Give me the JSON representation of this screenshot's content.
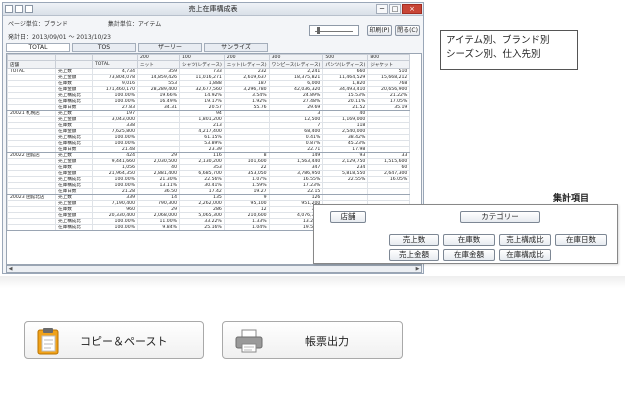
{
  "window": {
    "title": "売上在庫構成表",
    "controls": {
      "minimize": "─",
      "maximize": "□",
      "close": "×"
    }
  },
  "info": {
    "page_unit": "ページ単位：ブランド",
    "aggregate_unit": "集計単位：アイテム",
    "period": "発計日：2013/09/01 ～ 2013/10/23"
  },
  "header_buttons": {
    "print": "印刷(P)",
    "close": "閉る(C)"
  },
  "tabs": [
    "TOTAL",
    "TOS",
    "ザーリー",
    "サンライズ"
  ],
  "table": {
    "col_codes": [
      "",
      "",
      "",
      "200",
      "100",
      "200",
      "300",
      "500",
      "800"
    ],
    "col_headers": [
      "店舗",
      "",
      "TOTAL",
      "ニット",
      "シャツ(レディース)",
      "ニット(レディース)",
      "ワンピース(レディース)",
      "パンツ(レディース)",
      "ジャケット"
    ],
    "groups": [
      {
        "store": "TOTAL",
        "rows": [
          {
            "metric": "売上数",
            "values": [
              "4,734",
              "359",
              "733",
              "232",
              "2,241",
              "660",
              "510"
            ]
          },
          {
            "metric": "売上金額",
            "values": [
              "73,804,078",
              "14,859,426",
              "11,016,271",
              "2,619,637",
              "18,375,821",
              "11,464,529",
              "15,668,212"
            ]
          },
          {
            "metric": "在庫数",
            "values": [
              "9,016",
              "553",
              "1,888",
              "187",
              "6,000",
              "1,820",
              "768"
            ]
          },
          {
            "metric": "在庫金額",
            "values": [
              "171,460,170",
              "28,289,400",
              "32,677,560",
              "3,296,780",
              "42,036,320",
              "34,493,410",
              "20,656,900"
            ]
          },
          {
            "metric": "売上構成比",
            "values": [
              "100.00%",
              "19.66%",
              "14.92%",
              "3.54%",
              "24.89%",
              "15.53%",
              "21.22%"
            ]
          },
          {
            "metric": "在庫構成比",
            "values": [
              "100.00%",
              "16.49%",
              "19.17%",
              "1.92%",
              "27.48%",
              "20.11%",
              "17.05%"
            ]
          },
          {
            "metric": "在庫日数",
            "values": [
              "27.83",
              "34.31",
              "20.57",
              "55.76",
              "29.69",
              "21.52",
              "35.19"
            ]
          }
        ]
      },
      {
        "store": "20021 札幌店",
        "rows": [
          {
            "metric": "売上数",
            "values": [
              "197",
              "",
              "94",
              "",
              "3",
              "40",
              ""
            ]
          },
          {
            "metric": "売上金額",
            "values": [
              "3,043,000",
              "",
              "1,801,200",
              "",
              "12,500",
              "1,169,000",
              ""
            ]
          },
          {
            "metric": "在庫数",
            "values": [
              "338",
              "",
              "213",
              "",
              "7",
              "118",
              ""
            ]
          },
          {
            "metric": "在庫金額",
            "values": [
              "7,625,800",
              "",
              "4,217,400",
              "",
              "68,400",
              "2,540,000",
              ""
            ]
          },
          {
            "metric": "売上構成比",
            "values": [
              "100.00%",
              "",
              "61.15%",
              "",
              "0.41%",
              "38.42%",
              ""
            ]
          },
          {
            "metric": "在庫構成比",
            "values": [
              "100.00%",
              "",
              "53.89%",
              "",
              "0.87%",
              "45.23%",
              ""
            ]
          },
          {
            "metric": "在庫日数",
            "values": [
              "21.48",
              "",
              "23.39",
              "",
              "22.71",
              "17.98",
              ""
            ]
          }
        ]
      },
      {
        "store": "20022 函館店",
        "rows": [
          {
            "metric": "売上数",
            "values": [
              "424",
              "29",
              "116",
              "8",
              "149",
              "93",
              "33"
            ]
          },
          {
            "metric": "売上金額",
            "values": [
              "9,441,660",
              "2,030,500",
              "2,130,200",
              "101,600",
              "1,563,440",
              "2,129,750",
              "1,515,600"
            ]
          },
          {
            "metric": "在庫数",
            "values": [
              "1,056",
              "40",
              "353",
              "22",
              "347",
              "234",
              "60"
            ]
          },
          {
            "metric": "在庫金額",
            "values": [
              "21,964,350",
              "2,881,400",
              "6,685,700",
              "353,050",
              "3,786,950",
              "5,818,550",
              "2,647,300"
            ]
          },
          {
            "metric": "売上構成比",
            "values": [
              "100.00%",
              "21.30%",
              "22.56%",
              "1.07%",
              "16.55%",
              "22.55%",
              "16.05%"
            ]
          },
          {
            "metric": "在庫構成比",
            "values": [
              "100.00%",
              "13.11%",
              "30.41%",
              "1.59%",
              "17.23%",
              "",
              ""
            ]
          },
          {
            "metric": "在庫日数",
            "values": [
              "21.28",
              "36.50",
              "17.42",
              "19.27",
              "22.15",
              "",
              ""
            ]
          }
        ]
      },
      {
        "store": "20023 函館北店",
        "rows": [
          {
            "metric": "売上数",
            "values": [
              "339",
              "14",
              "135",
              "9",
              "126",
              "",
              ""
            ]
          },
          {
            "metric": "売上金額",
            "values": [
              "7,190,400",
              "790,300",
              "2,262,000",
              "95,100",
              "951,200",
              "",
              ""
            ]
          },
          {
            "metric": "在庫数",
            "values": [
              "960",
              "29",
              "286",
              "12",
              "357",
              "",
              ""
            ]
          },
          {
            "metric": "在庫金額",
            "values": [
              "20,330,400",
              "2,068,000",
              "5,065,300",
              "210,600",
              "4,076,300",
              "",
              ""
            ]
          },
          {
            "metric": "売上構成比",
            "values": [
              "100.00%",
              "11.00%",
              "33.22%",
              "1.33%",
              "13.21%",
              "",
              ""
            ]
          },
          {
            "metric": "在庫構成比",
            "values": [
              "100.00%",
              "9.84%",
              "25.16%",
              "1.04%",
              "19.56%",
              "",
              ""
            ]
          }
        ]
      }
    ]
  },
  "callout": {
    "line1": "アイテム別、ブランド別",
    "line2": "シーズン別、仕入先別"
  },
  "aggregate": {
    "title": "集計項目",
    "store_label": "店舗",
    "category_label": "カテゴリー",
    "row1": [
      "売上数",
      "在庫数",
      "売上構成比",
      "在庫日数"
    ],
    "row2": [
      "売上金額",
      "在庫金額",
      "在庫構成比"
    ]
  },
  "actions": {
    "copy_paste": "コピー＆ペースト",
    "print_report": "帳票出力"
  }
}
